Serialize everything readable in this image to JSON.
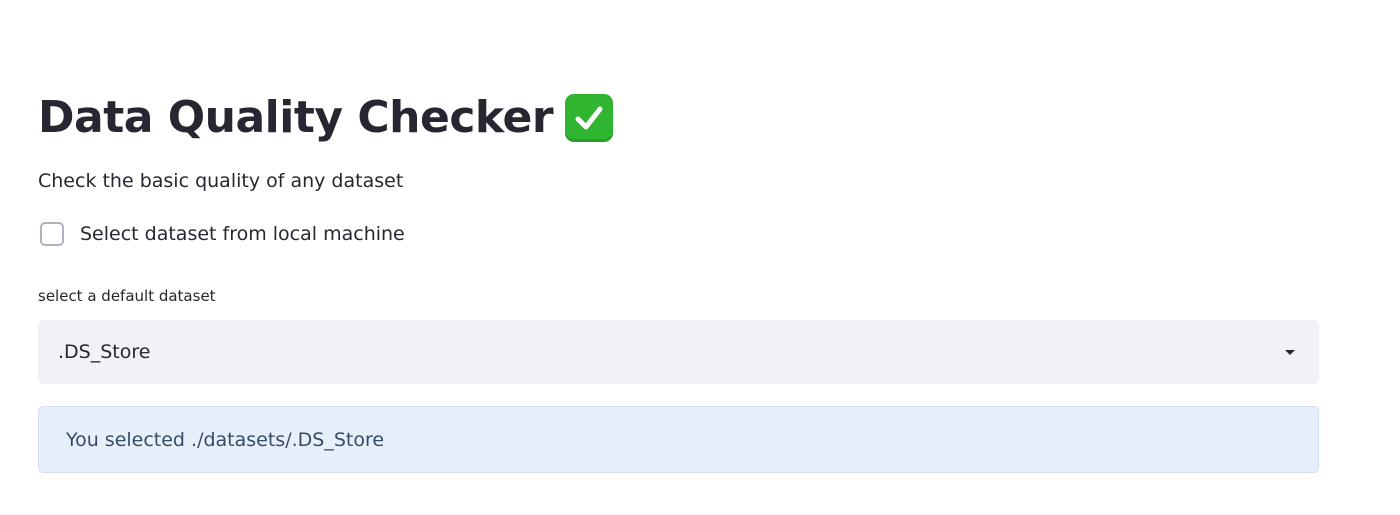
{
  "header": {
    "title": "Data Quality Checker",
    "title_emoji_icon": "check-mark-button-icon",
    "subtitle": "Check the basic quality of any dataset"
  },
  "local_checkbox": {
    "label": "Select dataset from local machine",
    "checked": false
  },
  "dataset_select": {
    "label": "select a default dataset",
    "selected_value": ".DS_Store",
    "icon": "caret-down-icon"
  },
  "info": {
    "message": "You selected ./datasets/.DS_Store"
  },
  "colors": {
    "text": "#262730",
    "select_bg": "#f0f2f6",
    "info_bg": "#e7f0fa",
    "info_text": "#3a4a66",
    "emoji_green": "#2fb52f"
  }
}
